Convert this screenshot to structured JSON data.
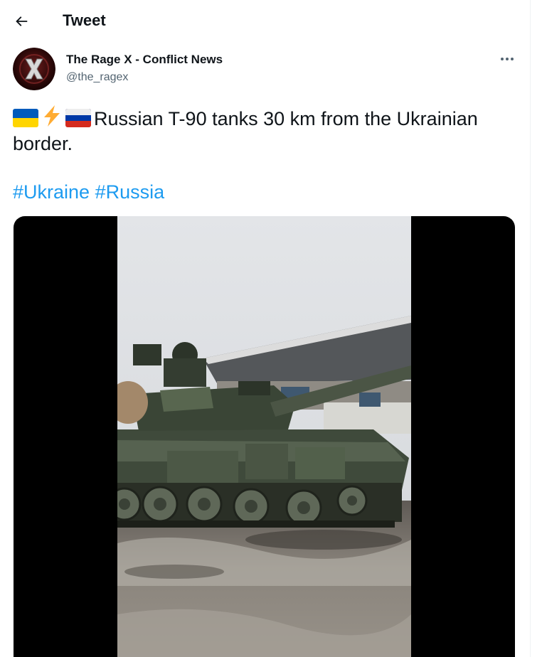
{
  "header": {
    "title": "Tweet",
    "back_icon": "arrow-left-icon"
  },
  "author": {
    "name": "The Rage X - Conflict News",
    "handle": "@the_ragex",
    "avatar_letter": "X"
  },
  "tweet": {
    "emoji_prefix": [
      "ukraine-flag-icon",
      "lightning-icon",
      "russia-flag-icon"
    ],
    "text": "Russian T-90 tanks 30 km from the Ukrainian border.",
    "hashtags": [
      "#Ukraine",
      "#Russia"
    ]
  },
  "colors": {
    "link": "#1d9bf0",
    "text": "#0f1419",
    "secondary": "#536471"
  }
}
